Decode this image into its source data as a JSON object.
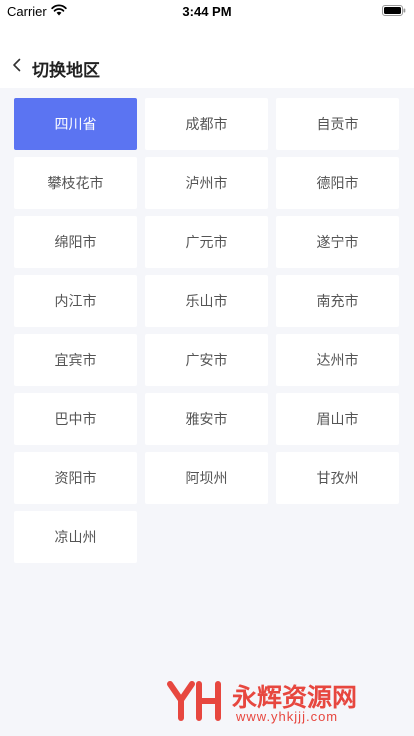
{
  "status_bar": {
    "carrier": "Carrier",
    "time": "3:44 PM",
    "wifi_icon": "wifi-icon",
    "battery_icon": "battery-icon"
  },
  "header": {
    "back_icon": "chevron-left-icon",
    "title": "切换地区"
  },
  "regions": {
    "selected_index": 0,
    "selected_color": "#5b74f2",
    "items": [
      {
        "label": "四川省"
      },
      {
        "label": "成都市"
      },
      {
        "label": "自贡市"
      },
      {
        "label": "攀枝花市"
      },
      {
        "label": "泸州市"
      },
      {
        "label": "德阳市"
      },
      {
        "label": "绵阳市"
      },
      {
        "label": "广元市"
      },
      {
        "label": "遂宁市"
      },
      {
        "label": "内江市"
      },
      {
        "label": "乐山市"
      },
      {
        "label": "南充市"
      },
      {
        "label": "宜宾市"
      },
      {
        "label": "广安市"
      },
      {
        "label": "达州市"
      },
      {
        "label": "巴中市"
      },
      {
        "label": "雅安市"
      },
      {
        "label": "眉山市"
      },
      {
        "label": "资阳市"
      },
      {
        "label": "阿坝州"
      },
      {
        "label": "甘孜州"
      },
      {
        "label": "凉山州"
      }
    ]
  },
  "watermark": {
    "logo_text": "YH",
    "name": "永辉资源网",
    "url": "www.yhkjjj.com",
    "color": "#e7473f"
  }
}
